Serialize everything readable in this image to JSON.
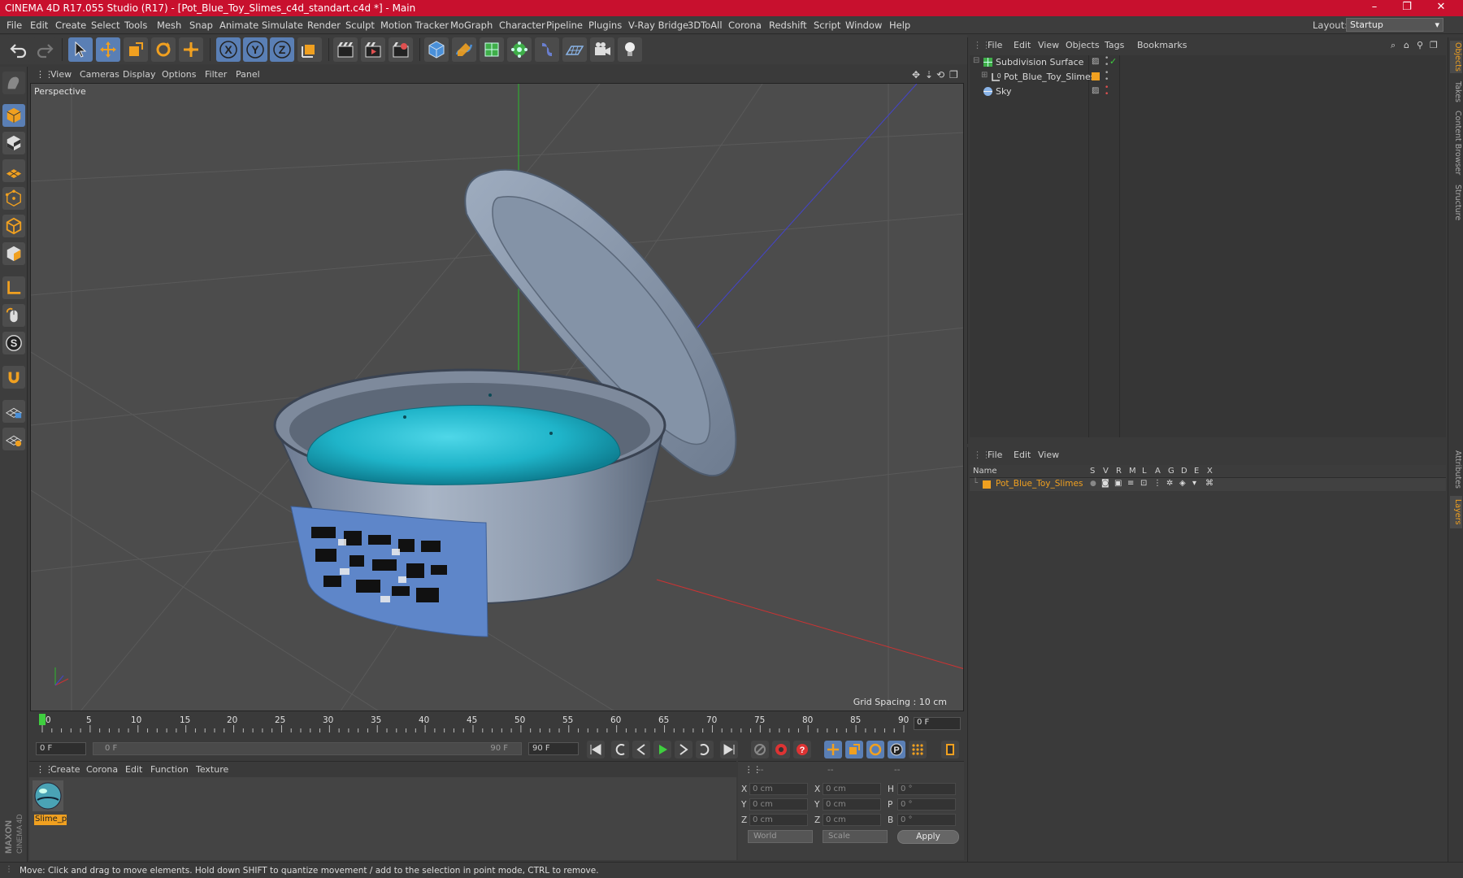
{
  "window": {
    "title": "CINEMA 4D R17.055 Studio (R17) - [Pot_Blue_Toy_Slimes_c4d_standart.c4d *] - Main",
    "minimize": "–",
    "maximize": "❐",
    "close": "✕"
  },
  "menubar": {
    "items": [
      "File",
      "Edit",
      "Create",
      "Select",
      "Tools",
      "Mesh",
      "Snap",
      "Animate",
      "Simulate",
      "Render",
      "Sculpt",
      "Motion Tracker",
      "MoGraph",
      "Character",
      "Pipeline",
      "Plugins",
      "V-Ray Bridge",
      "3DToAll",
      "Corona",
      "Redshift",
      "Script",
      "Window",
      "Help"
    ],
    "layout_label": "Layout:",
    "layout_value": "Startup"
  },
  "viewport": {
    "menu": [
      "View",
      "Cameras",
      "Display",
      "Options",
      "Filter",
      "Panel"
    ],
    "label": "Perspective",
    "grid_spacing": "Grid Spacing : 10 cm"
  },
  "timeline": {
    "ticks": [
      "0",
      "5",
      "10",
      "15",
      "20",
      "25",
      "30",
      "35",
      "40",
      "45",
      "50",
      "55",
      "60",
      "65",
      "70",
      "75",
      "80",
      "85",
      "90"
    ],
    "current_frame": "0 F"
  },
  "transport": {
    "start_field": "0 F",
    "range_start": "0 F",
    "range_end": "90 F",
    "end_field": "90 F"
  },
  "material_manager": {
    "menu": [
      "Create",
      "Corona",
      "Edit",
      "Function",
      "Texture"
    ],
    "material_name": "Slime_p"
  },
  "coordinates": {
    "headers": [
      "--",
      "--",
      "--"
    ],
    "rows": [
      {
        "axis": "X",
        "pos": "0 cm",
        "axis2": "X",
        "size": "0 cm",
        "rot_label": "H",
        "rot": "0 °"
      },
      {
        "axis": "Y",
        "pos": "0 cm",
        "axis2": "Y",
        "size": "0 cm",
        "rot_label": "P",
        "rot": "0 °"
      },
      {
        "axis": "Z",
        "pos": "0 cm",
        "axis2": "Z",
        "size": "0 cm",
        "rot_label": "B",
        "rot": "0 °"
      }
    ],
    "mode_select": "World",
    "size_select": "Scale",
    "apply_label": "Apply"
  },
  "object_manager": {
    "menu": [
      "File",
      "Edit",
      "View",
      "Objects",
      "Tags",
      "Bookmarks"
    ],
    "objects": [
      {
        "name": "Subdivision Surface"
      },
      {
        "name": "Pot_Blue_Toy_Slimes"
      },
      {
        "name": "Sky"
      }
    ]
  },
  "layer_manager": {
    "menu": [
      "File",
      "Edit",
      "View"
    ],
    "columns": [
      "Name",
      "S",
      "V",
      "R",
      "M",
      "L",
      "A",
      "G",
      "D",
      "E",
      "X"
    ],
    "layer_name": "Pot_Blue_Toy_Slimes",
    "layer_color": "#f0a020"
  },
  "right_tabs": [
    "Objects",
    "Takes",
    "Content Browser",
    "Structure",
    "Attributes",
    "Layers"
  ],
  "status": {
    "text": "Move: Click and drag to move elements. Hold down SHIFT to quantize movement / add to the selection in point mode, CTRL to remove."
  },
  "colors": {
    "title_bar": "#c8102e",
    "accent_orange": "#f0a020",
    "slime_cyan": "#1fb4c9"
  }
}
